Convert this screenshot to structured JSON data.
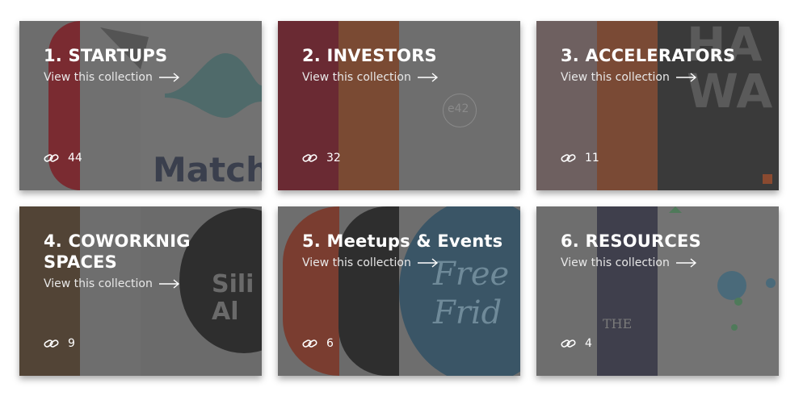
{
  "cards": [
    {
      "title": "1. STARTUPS",
      "link": "View this collection",
      "count": "44",
      "deco_text": "Match"
    },
    {
      "title": "2. INVESTORS",
      "link": "View this collection",
      "count": "32",
      "deco_text": "e42"
    },
    {
      "title": "3. ACCELERATORS",
      "link": "View this collection",
      "count": "11",
      "deco_text": "HA WA"
    },
    {
      "title": "4. COWORKNIG SPACES",
      "link": "View this collection",
      "count": "9",
      "deco_text": "Sili Al"
    },
    {
      "title": "5. Meetups & Events",
      "link": "View this collection",
      "count": "6",
      "deco_text": "Free Frid"
    },
    {
      "title": "6. RESOURCES",
      "link": "View this collection",
      "count": "4",
      "deco_text": "THE"
    }
  ],
  "icons": {
    "count": "link-icon",
    "arrow": "arrow-right-icon"
  },
  "colors": {
    "card_overlay": "#6b6b6b",
    "text": "#ffffff"
  }
}
